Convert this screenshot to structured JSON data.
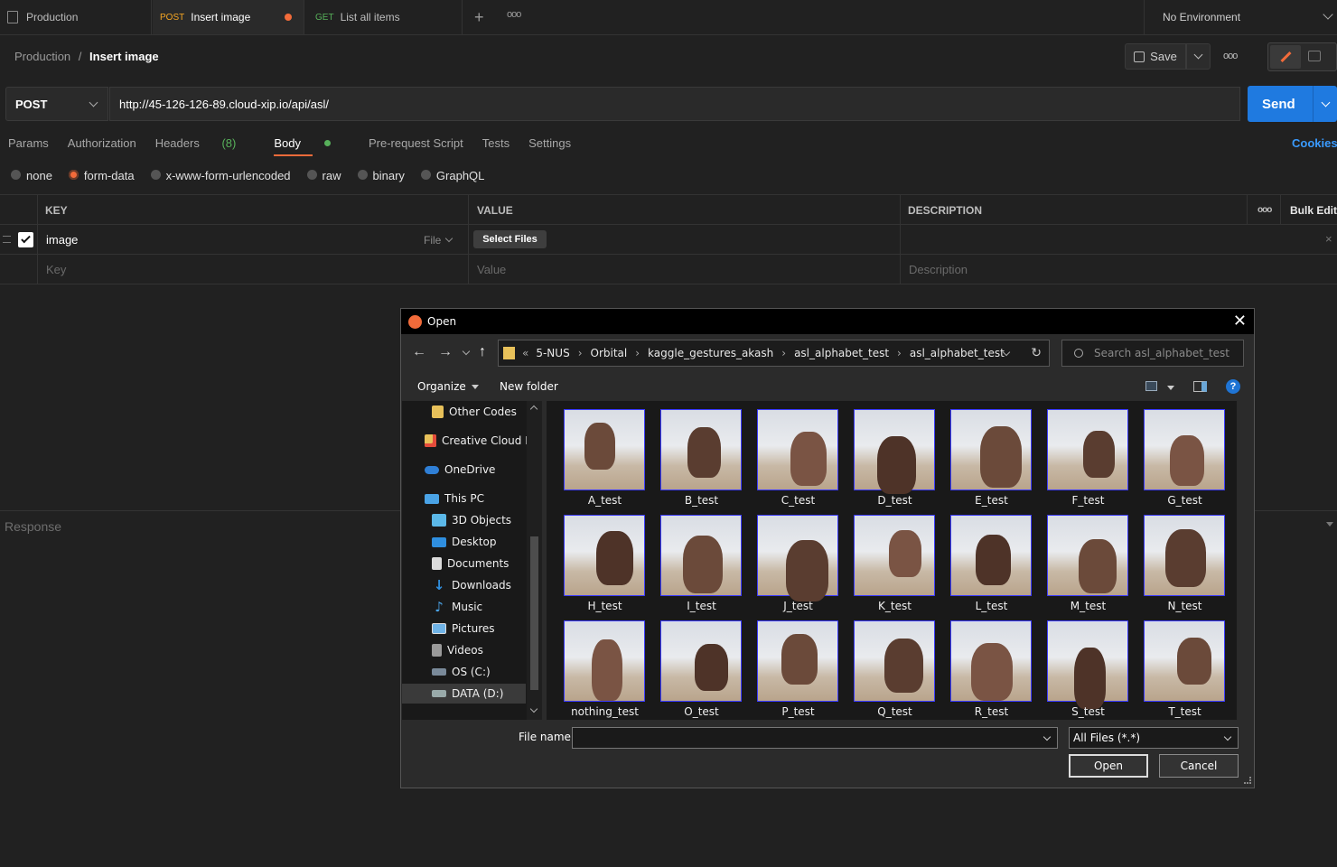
{
  "tabs": [
    {
      "method": "",
      "label": "Production"
    },
    {
      "method": "POST",
      "label": "Insert image"
    },
    {
      "method": "GET",
      "label": "List all items"
    }
  ],
  "environment": "No Environment",
  "breadcrumb": {
    "parent": "Production",
    "separator": "/",
    "current": "Insert image"
  },
  "toolbar": {
    "save_label": "Save"
  },
  "request": {
    "method": "POST",
    "url": "http://45-126-126-89.cloud-xip.io/api/asl/",
    "send_label": "Send"
  },
  "request_tabs": [
    "Params",
    "Authorization",
    "Headers",
    "(8)",
    "Body",
    "Pre-request Script",
    "Tests",
    "Settings"
  ],
  "cookies_label": "Cookies",
  "body_modes": [
    "none",
    "form-data",
    "x-www-form-urlencoded",
    "raw",
    "binary",
    "GraphQL"
  ],
  "form_table": {
    "headers": [
      "KEY",
      "VALUE",
      "DESCRIPTION"
    ],
    "bulk_edit": "Bulk Edit",
    "row": {
      "key": "image",
      "type": "File",
      "value_button": "Select Files"
    },
    "placeholders": {
      "key": "Key",
      "value": "Value",
      "description": "Description"
    }
  },
  "response_label": "Response",
  "dialog": {
    "title": "Open",
    "path": [
      "5-NUS",
      "Orbital",
      "kaggle_gestures_akash",
      "asl_alphabet_test",
      "asl_alphabet_test"
    ],
    "search_placeholder": "Search asl_alphabet_test",
    "organize": "Organize",
    "new_folder": "New folder",
    "nav": [
      "Other Codes",
      "Creative Cloud Fil",
      "OneDrive",
      "This PC",
      "3D Objects",
      "Desktop",
      "Documents",
      "Downloads",
      "Music",
      "Pictures",
      "Videos",
      "OS (C:)",
      "DATA (D:)"
    ],
    "files": [
      "A_test",
      "B_test",
      "C_test",
      "D_test",
      "E_test",
      "F_test",
      "G_test",
      "H_test",
      "I_test",
      "J_test",
      "K_test",
      "L_test",
      "M_test",
      "N_test",
      "nothing_test",
      "O_test",
      "P_test",
      "Q_test",
      "R_test",
      "S_test",
      "T_test"
    ],
    "filename_label": "File name:",
    "filename_value": "",
    "filetype": "All Files (*.*)",
    "open_button": "Open",
    "cancel_button": "Cancel"
  },
  "colors": {
    "accent": "#f26b3a",
    "send": "#1f7ae0",
    "link": "#3a9bff"
  }
}
